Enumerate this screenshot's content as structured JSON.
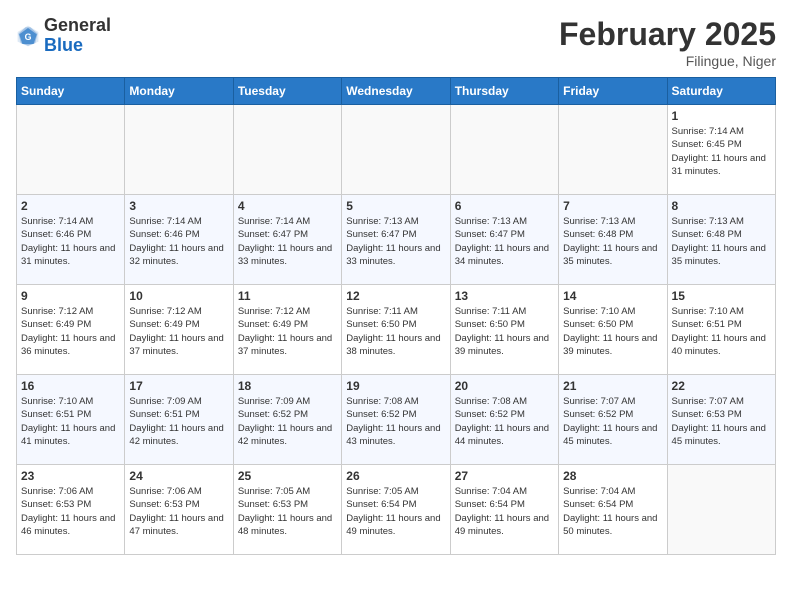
{
  "header": {
    "logo_line1": "General",
    "logo_line2": "Blue",
    "month_title": "February 2025",
    "location": "Filingue, Niger"
  },
  "days_of_week": [
    "Sunday",
    "Monday",
    "Tuesday",
    "Wednesday",
    "Thursday",
    "Friday",
    "Saturday"
  ],
  "weeks": [
    [
      {
        "day": "",
        "info": ""
      },
      {
        "day": "",
        "info": ""
      },
      {
        "day": "",
        "info": ""
      },
      {
        "day": "",
        "info": ""
      },
      {
        "day": "",
        "info": ""
      },
      {
        "day": "",
        "info": ""
      },
      {
        "day": "1",
        "info": "Sunrise: 7:14 AM\nSunset: 6:45 PM\nDaylight: 11 hours and 31 minutes."
      }
    ],
    [
      {
        "day": "2",
        "info": "Sunrise: 7:14 AM\nSunset: 6:46 PM\nDaylight: 11 hours and 31 minutes."
      },
      {
        "day": "3",
        "info": "Sunrise: 7:14 AM\nSunset: 6:46 PM\nDaylight: 11 hours and 32 minutes."
      },
      {
        "day": "4",
        "info": "Sunrise: 7:14 AM\nSunset: 6:47 PM\nDaylight: 11 hours and 33 minutes."
      },
      {
        "day": "5",
        "info": "Sunrise: 7:13 AM\nSunset: 6:47 PM\nDaylight: 11 hours and 33 minutes."
      },
      {
        "day": "6",
        "info": "Sunrise: 7:13 AM\nSunset: 6:47 PM\nDaylight: 11 hours and 34 minutes."
      },
      {
        "day": "7",
        "info": "Sunrise: 7:13 AM\nSunset: 6:48 PM\nDaylight: 11 hours and 35 minutes."
      },
      {
        "day": "8",
        "info": "Sunrise: 7:13 AM\nSunset: 6:48 PM\nDaylight: 11 hours and 35 minutes."
      }
    ],
    [
      {
        "day": "9",
        "info": "Sunrise: 7:12 AM\nSunset: 6:49 PM\nDaylight: 11 hours and 36 minutes."
      },
      {
        "day": "10",
        "info": "Sunrise: 7:12 AM\nSunset: 6:49 PM\nDaylight: 11 hours and 37 minutes."
      },
      {
        "day": "11",
        "info": "Sunrise: 7:12 AM\nSunset: 6:49 PM\nDaylight: 11 hours and 37 minutes."
      },
      {
        "day": "12",
        "info": "Sunrise: 7:11 AM\nSunset: 6:50 PM\nDaylight: 11 hours and 38 minutes."
      },
      {
        "day": "13",
        "info": "Sunrise: 7:11 AM\nSunset: 6:50 PM\nDaylight: 11 hours and 39 minutes."
      },
      {
        "day": "14",
        "info": "Sunrise: 7:10 AM\nSunset: 6:50 PM\nDaylight: 11 hours and 39 minutes."
      },
      {
        "day": "15",
        "info": "Sunrise: 7:10 AM\nSunset: 6:51 PM\nDaylight: 11 hours and 40 minutes."
      }
    ],
    [
      {
        "day": "16",
        "info": "Sunrise: 7:10 AM\nSunset: 6:51 PM\nDaylight: 11 hours and 41 minutes."
      },
      {
        "day": "17",
        "info": "Sunrise: 7:09 AM\nSunset: 6:51 PM\nDaylight: 11 hours and 42 minutes."
      },
      {
        "day": "18",
        "info": "Sunrise: 7:09 AM\nSunset: 6:52 PM\nDaylight: 11 hours and 42 minutes."
      },
      {
        "day": "19",
        "info": "Sunrise: 7:08 AM\nSunset: 6:52 PM\nDaylight: 11 hours and 43 minutes."
      },
      {
        "day": "20",
        "info": "Sunrise: 7:08 AM\nSunset: 6:52 PM\nDaylight: 11 hours and 44 minutes."
      },
      {
        "day": "21",
        "info": "Sunrise: 7:07 AM\nSunset: 6:52 PM\nDaylight: 11 hours and 45 minutes."
      },
      {
        "day": "22",
        "info": "Sunrise: 7:07 AM\nSunset: 6:53 PM\nDaylight: 11 hours and 45 minutes."
      }
    ],
    [
      {
        "day": "23",
        "info": "Sunrise: 7:06 AM\nSunset: 6:53 PM\nDaylight: 11 hours and 46 minutes."
      },
      {
        "day": "24",
        "info": "Sunrise: 7:06 AM\nSunset: 6:53 PM\nDaylight: 11 hours and 47 minutes."
      },
      {
        "day": "25",
        "info": "Sunrise: 7:05 AM\nSunset: 6:53 PM\nDaylight: 11 hours and 48 minutes."
      },
      {
        "day": "26",
        "info": "Sunrise: 7:05 AM\nSunset: 6:54 PM\nDaylight: 11 hours and 49 minutes."
      },
      {
        "day": "27",
        "info": "Sunrise: 7:04 AM\nSunset: 6:54 PM\nDaylight: 11 hours and 49 minutes."
      },
      {
        "day": "28",
        "info": "Sunrise: 7:04 AM\nSunset: 6:54 PM\nDaylight: 11 hours and 50 minutes."
      },
      {
        "day": "",
        "info": ""
      }
    ]
  ]
}
